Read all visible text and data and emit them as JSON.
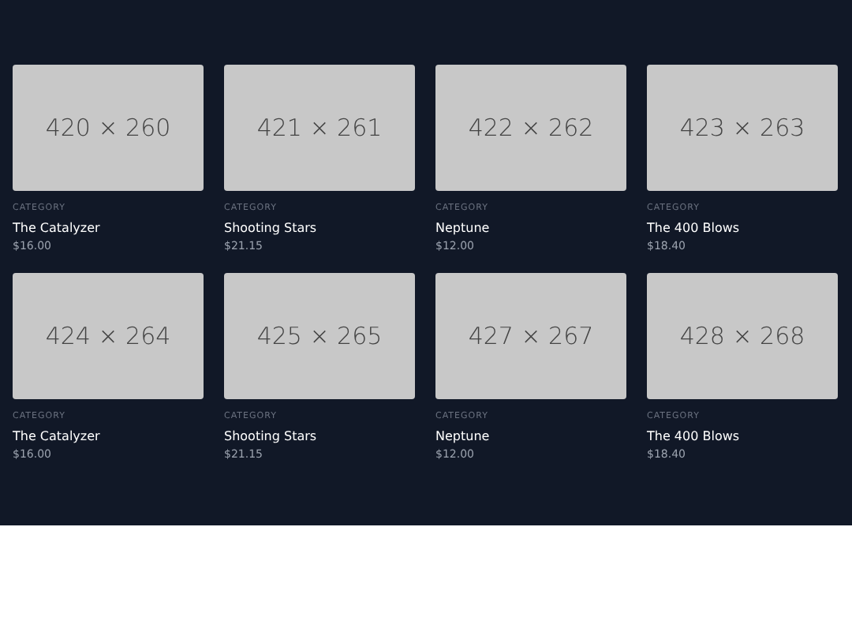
{
  "products": [
    {
      "image_label": "420 × 260",
      "category": "CATEGORY",
      "title": "The Catalyzer",
      "price": "$16.00"
    },
    {
      "image_label": "421 × 261",
      "category": "CATEGORY",
      "title": "Shooting Stars",
      "price": "$21.15"
    },
    {
      "image_label": "422 × 262",
      "category": "CATEGORY",
      "title": "Neptune",
      "price": "$12.00"
    },
    {
      "image_label": "423 × 263",
      "category": "CATEGORY",
      "title": "The 400 Blows",
      "price": "$18.40"
    },
    {
      "image_label": "424 × 264",
      "category": "CATEGORY",
      "title": "The Catalyzer",
      "price": "$16.00"
    },
    {
      "image_label": "425 × 265",
      "category": "CATEGORY",
      "title": "Shooting Stars",
      "price": "$21.15"
    },
    {
      "image_label": "427 × 267",
      "category": "CATEGORY",
      "title": "Neptune",
      "price": "$12.00"
    },
    {
      "image_label": "428 × 268",
      "category": "CATEGORY",
      "title": "The 400 Blows",
      "price": "$18.40"
    }
  ]
}
